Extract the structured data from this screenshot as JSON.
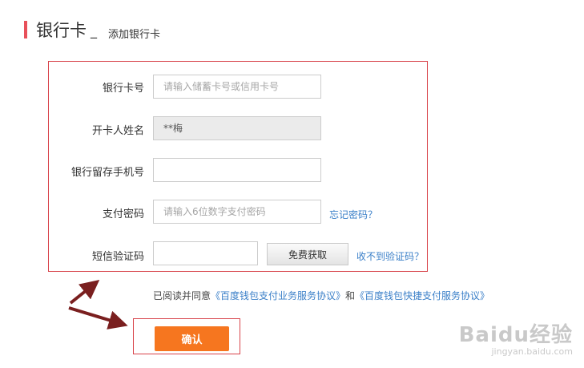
{
  "header": {
    "title": "银行卡",
    "separator": "_",
    "subtitle": "添加银行卡"
  },
  "form": {
    "card_number": {
      "label": "银行卡号",
      "placeholder": "请输入储蓄卡号或信用卡号"
    },
    "holder_name": {
      "label": "开卡人姓名",
      "value": "**梅"
    },
    "phone": {
      "label": "银行留存手机号",
      "value": ""
    },
    "pay_password": {
      "label": "支付密码",
      "placeholder": "请输入6位数字支付密码",
      "forgot_link": "忘记密码？"
    },
    "sms_code": {
      "label": "短信验证码",
      "value": "",
      "get_button": "免费获取",
      "not_received_link": "收不到验证码？"
    }
  },
  "agreement": {
    "prefix": "已阅读并同意",
    "link1": "《百度钱包支付业务服务协议》",
    "and": "和",
    "link2": "《百度钱包快捷支付服务协议》"
  },
  "confirm_button": "确认",
  "watermark": {
    "logo_text": "Baidu经验",
    "url": "jingyan.baidu.com"
  },
  "colors": {
    "accent_red": "#d8434a",
    "title_bar": "#e8505a",
    "confirm_orange": "#f6761f",
    "link_blue": "#3a7fc8"
  }
}
